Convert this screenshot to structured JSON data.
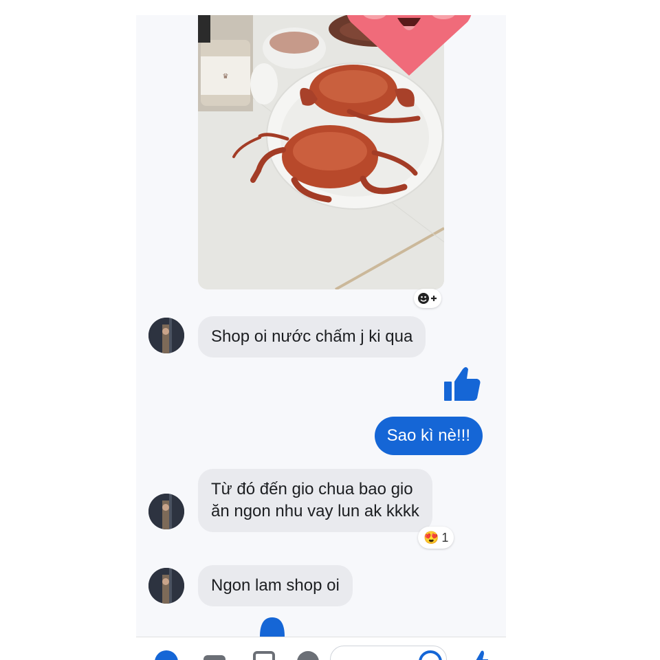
{
  "messages": [
    {
      "id": "m1",
      "side": "in",
      "text": "Shop oi nước chấm j ki qua"
    },
    {
      "id": "m2",
      "side": "out",
      "text": "Sao kì nè!!!"
    },
    {
      "id": "m3",
      "side": "in",
      "text": "Từ đó đến gio chua bao gio\năn ngon nhu vay lun ak kkkk"
    },
    {
      "id": "m4",
      "side": "in",
      "text": "Ngon lam shop oi"
    }
  ],
  "reaction": {
    "emoji": "😍",
    "count": "1"
  },
  "icons": {
    "heart_sticker": "smiling-heart-sticker",
    "add_reaction": "emoji-plus-icon",
    "like": "thumbs-up-icon",
    "typing": "typing-indicator",
    "composer": [
      "plus-icon",
      "camera-icon",
      "image-icon",
      "mic-icon",
      "smile-icon",
      "like-icon"
    ]
  },
  "colors": {
    "accent": "#1566d6",
    "incoming_bubble": "#e9eaee",
    "heart": "#f06b7a"
  }
}
